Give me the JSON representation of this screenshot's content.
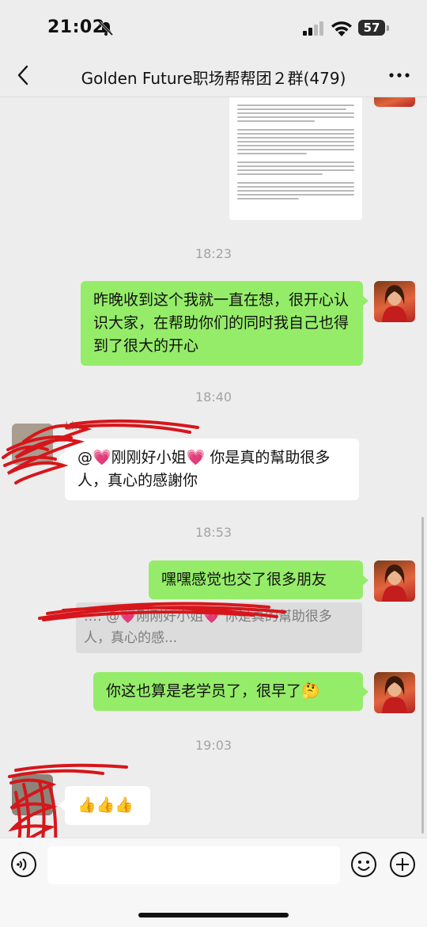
{
  "status_bar": {
    "time": "21:02",
    "battery": "57"
  },
  "nav": {
    "title": "Golden Future职场帮帮团２群(479)"
  },
  "document_preview": {
    "description_hidden": true
  },
  "messages": {
    "ts1": "18:23",
    "msg1": "昨晚收到这个我就一直在想，很开心认识大家，在帮助你们的同时我自己也得到了很大的开心",
    "ts2": "18:40",
    "sender2": "Li…",
    "msg2": "@💗刚刚好小姐💗 你是真的幫助很多人，真心的感謝你",
    "ts3": "18:53",
    "msg3": "嘿嘿感觉也交了很多朋友",
    "quote": "…: @💗刚刚好小姐💗 你是真的幫助很多人，真心的感...",
    "msg4": "你这也算是老学员了，很早了🤔",
    "ts4": "19:03",
    "msg5": "👍👍👍"
  },
  "input": {
    "placeholder": ""
  },
  "colors": {
    "sent_bubble": "#95ec69",
    "received_bubble": "#ffffff",
    "background": "#ededed",
    "redaction": "#d6161b"
  }
}
